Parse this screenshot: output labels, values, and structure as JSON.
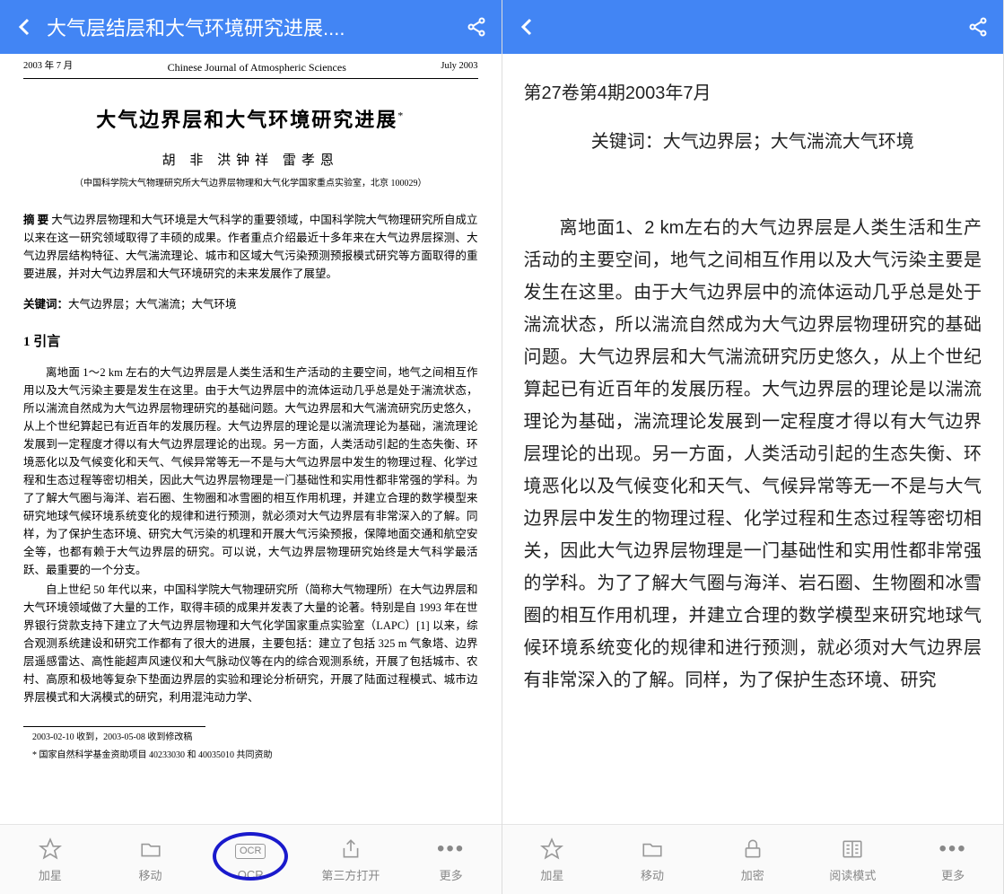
{
  "left": {
    "header": {
      "title": "大气层结层和大气环境研究进展...."
    },
    "doc": {
      "vol_date_cn": "2003 年 7 月",
      "journal": "Chinese Journal of Atmospheric Sciences",
      "issue_date_en": "July   2003",
      "title": "大气边界层和大气环境研究进展",
      "title_mark": "*",
      "authors": "胡 非   洪钟祥   雷孝恩",
      "affiliation": "（中国科学院大气物理研究所大气边界层物理和大气化学国家重点实验室，北京   100029）",
      "abstract_label": "摘   要",
      "abstract_text": "      大气边界层物理和大气环境是大气科学的重要领域，中国科学院大气物理研究所自成立以来在这一研究领域取得了丰硕的成果。作者重点介绍最近十多年来在大气边界层探测、大气边界层结构特征、大气湍流理论、城市和区域大气污染预测预报模式研究等方面取得的重要进展，并对大气边界层和大气环境研究的未来发展作了展望。",
      "keywords_label": "关键词：",
      "keywords_text": "大气边界层；大气湍流；大气环境",
      "section1_head": "1   引言",
      "p1": "离地面 1～2 km 左右的大气边界层是人类生活和生产活动的主要空间，地气之间相互作用以及大气污染主要是发生在这里。由于大气边界层中的流体运动几乎总是处于湍流状态，所以湍流自然成为大气边界层物理研究的基础问题。大气边界层和大气湍流研究历史悠久，从上个世纪算起已有近百年的发展历程。大气边界层的理论是以湍流理论为基础，湍流理论发展到一定程度才得以有大气边界层理论的出现。另一方面，人类活动引起的生态失衡、环境恶化以及气候变化和天气、气候异常等无一不是与大气边界层中发生的物理过程、化学过程和生态过程等密切相关，因此大气边界层物理是一门基础性和实用性都非常强的学科。为了了解大气圈与海洋、岩石圈、生物圈和冰雪圈的相互作用机理，并建立合理的数学模型来研究地球气候环境系统变化的规律和进行预测，就必须对大气边界层有非常深入的了解。同样，为了保护生态环境、研究大气污染的机理和开展大气污染预报，保障地面交通和航空安全等，也都有赖于大气边界层的研究。可以说，大气边界层物理研究始终是大气科学最活跃、最重要的一个分支。",
      "p2": "自上世纪 50 年代以来，中国科学院大气物理研究所（简称大气物理所）在大气边界层和大气环境领域做了大量的工作，取得丰硕的成果并发表了大量的论著。特别是自 1993 年在世界银行贷款支持下建立了大气边界层物理和大气化学国家重点实验室（LAPC）[1] 以来，综合观测系统建设和研究工作都有了很大的进展，主要包括：建立了包括 325 m 气象塔、边界层遥感雷达、高性能超声风速仪和大气脉动仪等在内的综合观测系统，开展了包括城市、农村、高原和极地等复杂下垫面边界层的实验和理论分析研究，开展了陆面过程模式、城市边界层模式和大涡模式的研究，利用混沌动力学、",
      "footnote1": "2003-02-10 收到，2003-05-08 收到修改稿",
      "footnote2": "*  国家自然科学基金资助项目 40233030 和 40035010 共同资助"
    },
    "bottombar": {
      "star": "加星",
      "move": "移动",
      "ocr": "OCR",
      "ocr_icon": "OCR",
      "open": "第三方打开",
      "more": "更多"
    }
  },
  "right": {
    "text": {
      "meta": "第27卷第4期2003年7月",
      "keywords": "关键词：大气边界层；大气湍流大气环境",
      "body": "离地面1、2 km左右的大气边界层是人类生活和生产活动的主要空间，地气之间相互作用以及大气污染主要是发生在这里。由于大气边界层中的流体运动几乎总是处于湍流状态，所以湍流自然成为大气边界层物理研究的基础问题。大气边界层和大气湍流研究历史悠久，从上个世纪算起已有近百年的发展历程。大气边界层的理论是以湍流理论为基础，湍流理论发展到一定程度才得以有大气边界层理论的出现。另一方面，人类活动引起的生态失衡、环境恶化以及气候变化和天气、气候异常等无一不是与大气边界层中发生的物理过程、化学过程和生态过程等密切相关，因此大气边界层物理是一门基础性和实用性都非常强的学科。为了了解大气圈与海洋、岩石圈、生物圈和冰雪圈的相互作用机理，并建立合理的数学模型来研究地球气候环境系统变化的规律和进行预测，就必须对大气边界层有非常深入的了解。同样，为了保护生态环境、研究"
    },
    "bottombar": {
      "star": "加星",
      "move": "移动",
      "encrypt": "加密",
      "readmode": "阅读模式",
      "more": "更多"
    }
  }
}
